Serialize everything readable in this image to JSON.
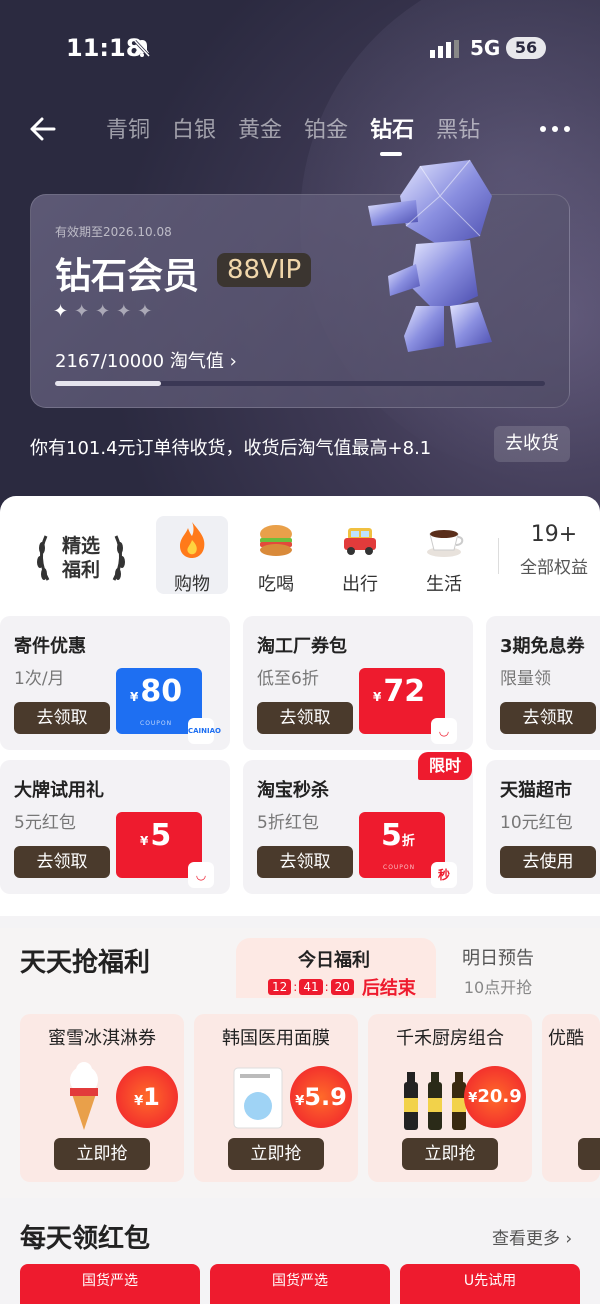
{
  "status": {
    "time": "11:18",
    "network": "5G",
    "battery": "56"
  },
  "nav": {
    "tabs": [
      "青铜",
      "白银",
      "黄金",
      "铂金",
      "钻石",
      "黑钻"
    ],
    "active_tab": "钻石"
  },
  "card": {
    "valid": "有效期至2026.10.08",
    "title": "钻石会员",
    "vip": "88VIP",
    "stars_filled": 1,
    "stars_total": 5,
    "score": "2167/10000 淘气值 ›",
    "progress": 0.2167
  },
  "order": {
    "text": "你有101.4元订单待收货，收货后淘气值最高+8.1",
    "button": "去收货"
  },
  "categories": {
    "featured_line1": "精选",
    "featured_line2": "福利",
    "items": [
      "购物",
      "吃喝",
      "出行",
      "生活"
    ],
    "all_count": "19+",
    "all_label": "全部权益"
  },
  "coupons": [
    {
      "title": "寄件优惠",
      "sub": "1次/月",
      "btn": "去领取",
      "value": "80",
      "unit": "",
      "color": "blue",
      "tag": "CAINIAO"
    },
    {
      "title": "淘工厂券包",
      "sub": "低至6折",
      "btn": "去领取",
      "value": "72",
      "unit": "",
      "color": "red",
      "tag": ""
    },
    {
      "title": "3期免息券",
      "sub": "限量领",
      "btn": "去领取"
    },
    {
      "title": "大牌试用礼",
      "sub": "5元红包",
      "btn": "去领取",
      "value": "5",
      "unit": "",
      "color": "red",
      "tag": ""
    },
    {
      "title": "淘宝秒杀",
      "sub": "5折红包",
      "btn": "去领取",
      "value": "5",
      "unit": "折",
      "color": "red",
      "tag": ""
    },
    {
      "title": "天猫超市",
      "sub": "10元红包",
      "btn": "去使用"
    }
  ],
  "limit_badge": "限时",
  "daily": {
    "title": "天天抢福利",
    "today": "今日福利",
    "timer": [
      "12",
      "41",
      "20"
    ],
    "timer_end": "后结束",
    "tomorrow": "明日预告",
    "tomorrow_sub": "10点开抢",
    "items": [
      {
        "name": "蜜雪冰淇淋券",
        "price": "1",
        "btn": "立即抢"
      },
      {
        "name": "韩国医用面膜",
        "price": "5.9",
        "btn": "立即抢"
      },
      {
        "name": "千禾厨房组合",
        "price": "20.9",
        "btn": "立即抢"
      },
      {
        "name": "优酷",
        "price": "",
        "btn": ""
      }
    ]
  },
  "redpack": {
    "title": "每天领红包",
    "more": "查看更多 ›",
    "items": [
      "国货严选",
      "国货严选",
      "U先试用"
    ]
  },
  "colors": {
    "accent": "#ee1b2e",
    "button": "#4a3a2c",
    "hero": "#2b2a40"
  }
}
